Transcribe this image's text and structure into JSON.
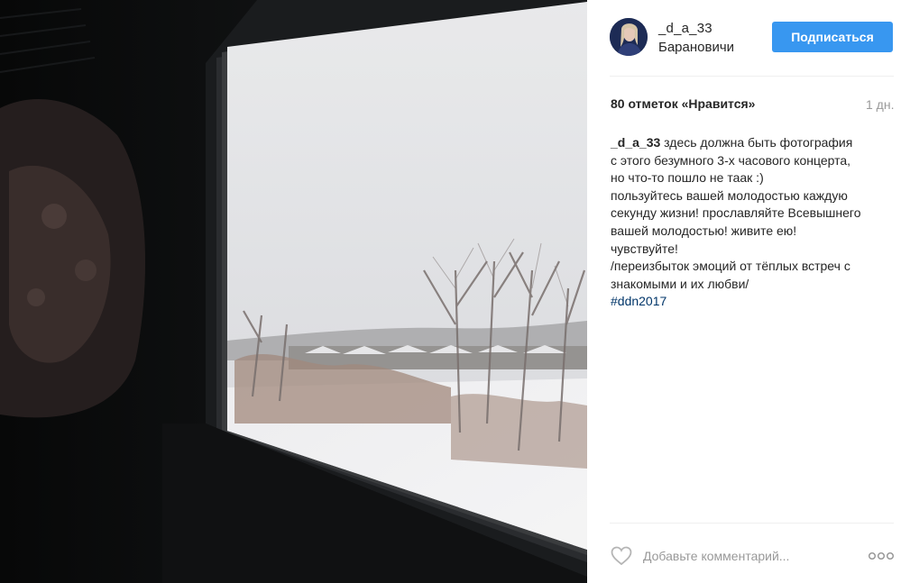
{
  "post": {
    "username": "_d_a_33",
    "location": "Барановичи",
    "follow_label": "Подписаться",
    "likes_label": "80 отметок «Нравится»",
    "time_ago": "1 дн.",
    "caption": {
      "author": "_d_a_33",
      "lines": [
        " здесь должна быть фотография",
        "с этого безумного 3-х часового концерта,",
        "но что-то пошло не таак :)",
        "пользуйтесь вашей молодостью каждую",
        "секунду жизни! прославляйте Всевышнего",
        "вашей молодостью! живите ею!",
        "чувствуйте!",
        "/переизбыток эмоций от тёплых встреч с",
        "знакомыми и их любви/"
      ],
      "hashtag": "#ddn2017"
    },
    "comment_placeholder": "Добавьте комментарий...",
    "icons": {
      "like": "heart-outline-icon",
      "more": "more-options-icon"
    }
  },
  "colors": {
    "accent": "#3897f0",
    "hashtag": "#003569",
    "muted": "#999999",
    "text": "#262626"
  }
}
